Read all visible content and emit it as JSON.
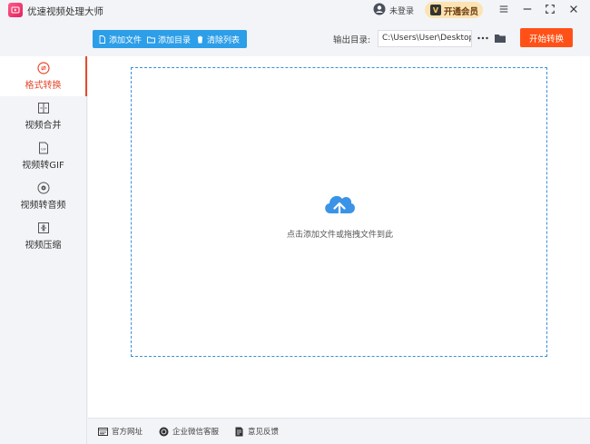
{
  "window": {
    "title": "优速视频处理大师",
    "login_text": "未登录",
    "vip_label": "开通会员",
    "vip_badge": "V"
  },
  "toolbar": {
    "add_file": "添加文件",
    "add_dir": "添加目录",
    "clear_list": "清除列表",
    "output_label": "输出目录:",
    "output_path": "C:\\Users\\User\\Desktop",
    "start_label": "开始转换"
  },
  "sidebar": {
    "items": [
      {
        "label": "格式转换",
        "icon": "format-convert-icon",
        "active": true
      },
      {
        "label": "视频合并",
        "icon": "merge-icon",
        "active": false
      },
      {
        "label": "视频转GIF",
        "icon": "gif-icon",
        "active": false
      },
      {
        "label": "视频转音频",
        "icon": "audio-icon",
        "active": false
      },
      {
        "label": "视频压缩",
        "icon": "compress-icon",
        "active": false
      }
    ]
  },
  "dropzone": {
    "text": "点击添加文件或拖拽文件到此"
  },
  "footer": {
    "website": "官方网址",
    "wechat": "企业微信客服",
    "feedback": "意见反馈"
  },
  "colors": {
    "accent_blue": "#2d9ee8",
    "start_orange": "#ff5117",
    "active_red": "#e64a2e",
    "vip_bg": "#fbe3b4"
  }
}
